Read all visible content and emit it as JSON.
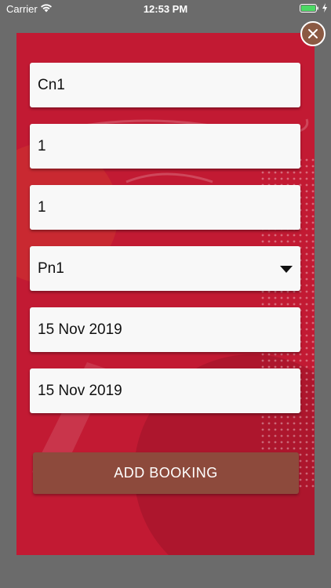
{
  "status_bar": {
    "carrier": "Carrier",
    "time": "12:53 PM",
    "wifi_icon": "wifi-icon",
    "battery_icon": "battery-full-icon",
    "charging_icon": "charging-bolt-icon"
  },
  "colors": {
    "overlay": "#6b6b6b",
    "modal_background": "#c21a33",
    "field_background": "#f8f8f8",
    "button_background": "#8d4a3c",
    "close_button_background": "#8b5a43",
    "battery": "#4cd964"
  },
  "modal": {
    "close_icon": "close-icon",
    "fields": [
      {
        "value": "Cn1"
      },
      {
        "value": "1"
      },
      {
        "value": "1"
      },
      {
        "value": "Pn1",
        "type": "dropdown"
      },
      {
        "value": "15 Nov 2019"
      },
      {
        "value": "15 Nov 2019"
      }
    ],
    "add_button_label": "ADD BOOKING"
  }
}
